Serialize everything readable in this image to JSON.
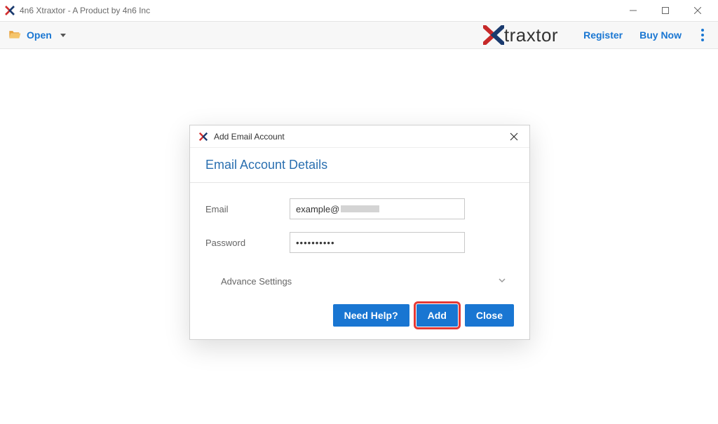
{
  "window": {
    "title": "4n6 Xtraxtor - A Product by 4n6 Inc"
  },
  "toolbar": {
    "open_label": "Open",
    "register_label": "Register",
    "buy_now_label": "Buy Now",
    "brand": "traxtor"
  },
  "dialog": {
    "title": "Add Email Account",
    "heading": "Email Account Details",
    "email_label": "Email",
    "email_value": "example@",
    "password_label": "Password",
    "password_value": "••••••••••",
    "advance_label": "Advance Settings",
    "buttons": {
      "need_help": "Need Help?",
      "add": "Add",
      "close": "Close"
    }
  }
}
